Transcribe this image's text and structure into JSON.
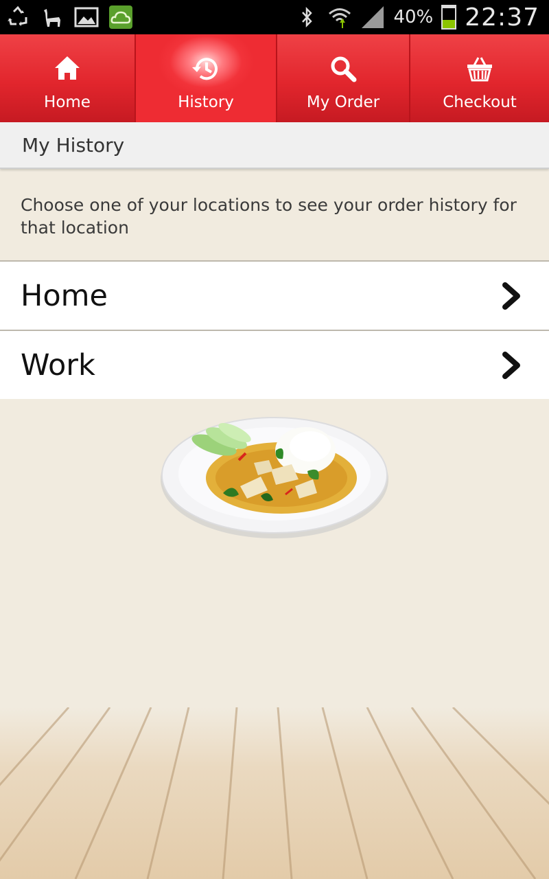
{
  "status_bar": {
    "battery_percent": "40%",
    "battery_level": 0.4,
    "time": "22:37",
    "icons": [
      "recycle-icon",
      "llama-icon",
      "image-icon",
      "cloud-app-icon",
      "bluetooth-icon",
      "wifi-icon",
      "signal-icon",
      "battery-icon"
    ],
    "battery_color": "#8bc400"
  },
  "tabs": [
    {
      "label": "Home",
      "icon": "home-icon",
      "active": false
    },
    {
      "label": "History",
      "icon": "history-icon",
      "active": true
    },
    {
      "label": "My Order",
      "icon": "search-icon",
      "active": false
    },
    {
      "label": "Checkout",
      "icon": "basket-icon",
      "active": false
    }
  ],
  "colors": {
    "brand_red": "#e2262d",
    "background": "#f1ebdf"
  },
  "page": {
    "title": "My History",
    "instructions": "Choose one of your locations to see your order history for that location"
  },
  "locations": [
    {
      "label": "Home",
      "icon": "chevron-right-icon"
    },
    {
      "label": "Work",
      "icon": "chevron-right-icon"
    }
  ]
}
